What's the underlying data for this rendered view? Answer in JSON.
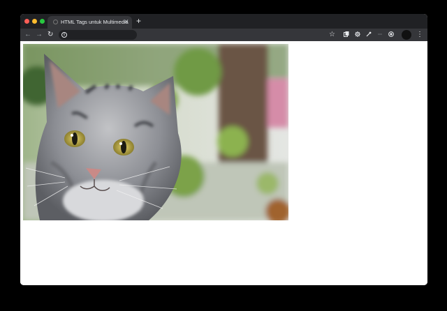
{
  "browser": {
    "tab": {
      "title": "HTML Tags untuk Multimedia",
      "close": "✕"
    },
    "new_tab": "+",
    "toolbar": {
      "back": "←",
      "forward": "→",
      "reload": "↻",
      "info": "i",
      "bookmark": "☆",
      "menu": "⋮"
    },
    "extensions": [
      "copy-icon",
      "gear-icon",
      "eyedropper-icon",
      "ellipsis-icon",
      "circle-extension-icon"
    ]
  },
  "page": {
    "image": {
      "alt": "",
      "subject": "grey tabby cat"
    }
  },
  "colors": {
    "chrome_dark": "#202124",
    "chrome_tab": "#35363a",
    "page_bg": "#ffffff"
  }
}
